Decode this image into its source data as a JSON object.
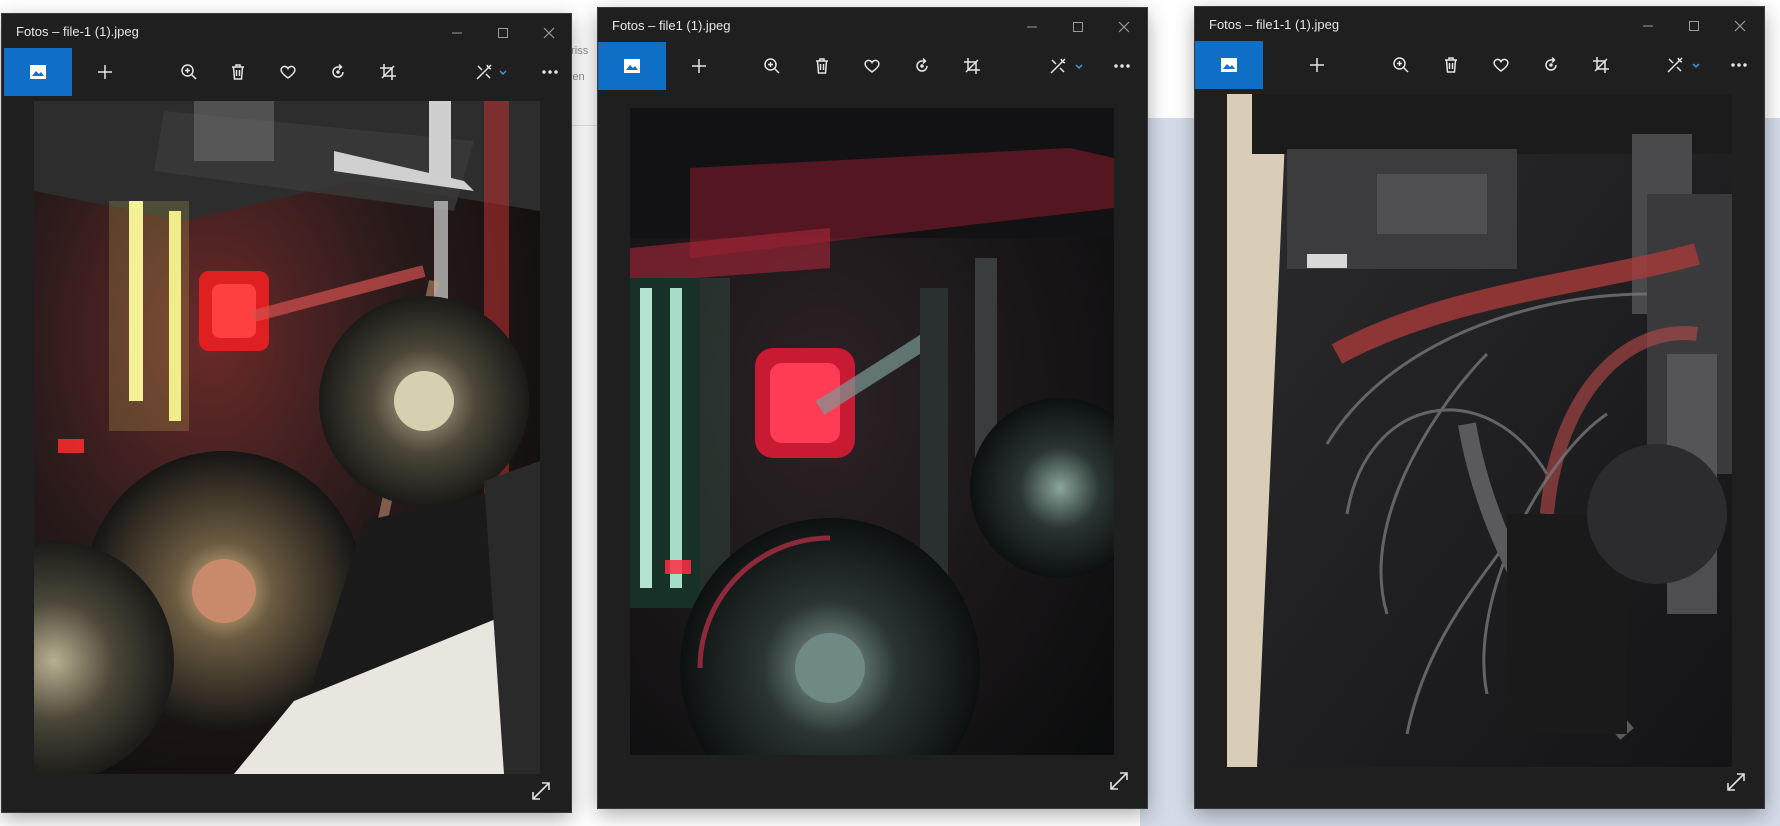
{
  "background": {
    "doc_lines": [
      "nriss",
      "illen"
    ]
  },
  "windows": [
    {
      "title": "Fotos – file-1 (1).jpeg"
    },
    {
      "title": "Fotos – file1 (1).jpeg"
    },
    {
      "title": "Fotos – file1-1 (1).jpeg"
    }
  ],
  "controls": {
    "minimize": "—",
    "maximize": "☐",
    "close": "✕"
  },
  "toolbar_icons": [
    "gallery-icon",
    "add-icon",
    "zoom-icon",
    "delete-icon",
    "favorite-icon",
    "rotate-icon",
    "crop-icon",
    "edit-icon",
    "more-icon"
  ],
  "colors": {
    "window_bg": "#1f1f1f",
    "accent": "#0f6fc6"
  }
}
